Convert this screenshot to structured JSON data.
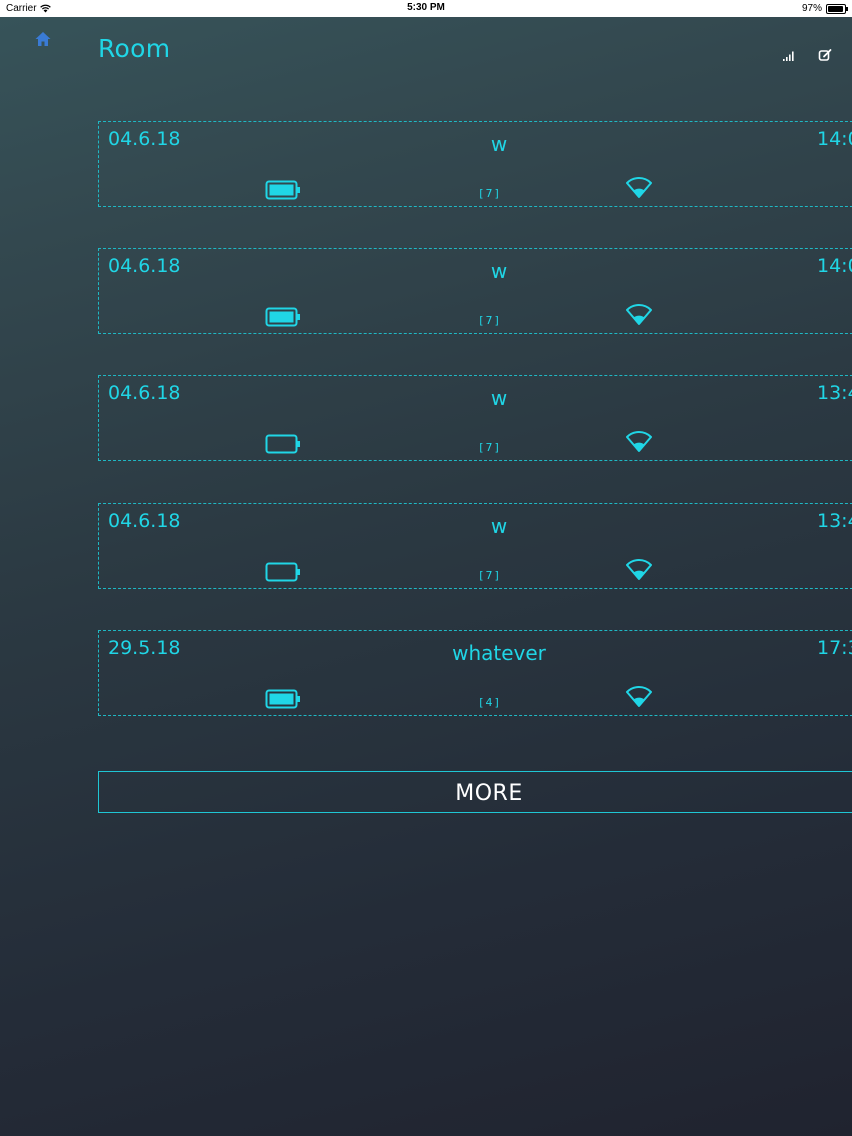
{
  "status_bar": {
    "carrier": "Carrier",
    "time": "5:30 PM",
    "battery": "97%"
  },
  "header": {
    "title": "Room"
  },
  "colors": {
    "accent": "#20d6e6",
    "border": "#1fb8c4",
    "home_icon": "#3a7bd5"
  },
  "entries": [
    {
      "date": "04.6.18",
      "name": "w",
      "time": "14:0",
      "count": "[7]",
      "battery": "full",
      "signal": "wifi-icon"
    },
    {
      "date": "04.6.18",
      "name": "w",
      "time": "14:0",
      "count": "[7]",
      "battery": "full",
      "signal": "wifi-icon"
    },
    {
      "date": "04.6.18",
      "name": "w",
      "time": "13:4",
      "count": "[7]",
      "battery": "empty",
      "signal": "wifi-icon"
    },
    {
      "date": "04.6.18",
      "name": "w",
      "time": "13:4",
      "count": "[7]",
      "battery": "empty",
      "signal": "wifi-icon"
    },
    {
      "date": "29.5.18",
      "name": "whatever",
      "time": "17:3",
      "count": "[4]",
      "battery": "full",
      "signal": "wifi-icon"
    }
  ],
  "more_button": {
    "label": "MORE"
  }
}
